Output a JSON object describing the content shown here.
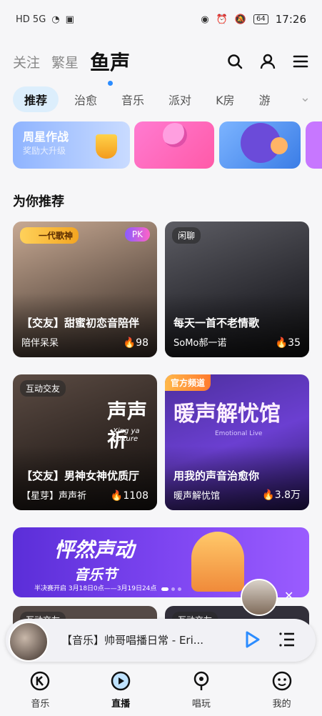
{
  "status_bar": {
    "left": "HD 5G",
    "time": "17:26",
    "battery": "64"
  },
  "header": {
    "tabs": [
      "关注",
      "繁星",
      "鱼声"
    ],
    "active": "鱼声"
  },
  "categories": [
    "推荐",
    "治愈",
    "音乐",
    "派对",
    "K房",
    "游"
  ],
  "banner_strip": {
    "card1_title": "周星作战",
    "card1_sub": "奖励大升级"
  },
  "section_title": "为你推荐",
  "rooms": [
    {
      "tag": "一代歌神",
      "pk": "PK",
      "title": "【交友】甜蜜初恋音陪伴",
      "host": "陪伴呆呆",
      "heat": "98"
    },
    {
      "tag": "闲聊",
      "title": "每天一首不老情歌",
      "host": "SoMo郝一诺",
      "heat": "35"
    },
    {
      "tag": "互动交友",
      "title": "【交友】男神女神优质厅",
      "host": "【星芽】声声祈",
      "heat": "1108",
      "art": "声声祈",
      "art_sub": "Xing ya culture"
    },
    {
      "tag": "官方频道",
      "title": "用我的声音治愈你",
      "host": "暖声解忧馆",
      "heat": "3.8万",
      "art": "暖声解忧馆",
      "art_sub": "Emotional Live"
    }
  ],
  "festival": {
    "title": "怦然声动",
    "subtitle": "音乐节",
    "dates": "半决赛开启 3月18日0点——3月19日24点"
  },
  "more_rooms": [
    {
      "tag": "互动交友"
    },
    {
      "tag": "互动交友"
    }
  ],
  "player": {
    "title": "【音乐】帅哥唱播日常 - Eri..."
  },
  "bottom_nav": [
    {
      "label": "音乐"
    },
    {
      "label": "直播"
    },
    {
      "label": "唱玩"
    },
    {
      "label": "我的"
    }
  ],
  "colors": {
    "accent": "#2b8cff",
    "active_tab_bg": "#dceefc"
  }
}
